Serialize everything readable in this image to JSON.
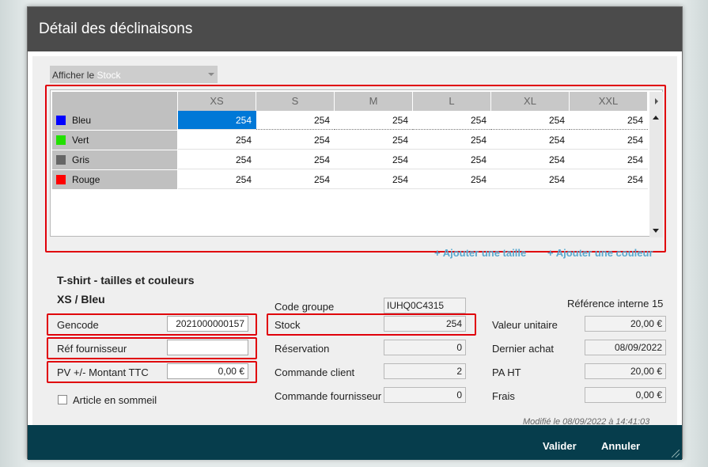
{
  "dialog": {
    "title": "Détail des déclinaisons"
  },
  "selector": {
    "prefix": "Afficher le",
    "value": "Stock"
  },
  "grid": {
    "columns": [
      "XS",
      "S",
      "M",
      "L",
      "XL",
      "XXL"
    ],
    "rows": [
      {
        "name": "Bleu",
        "color": "#0000ff",
        "values": [
          "254",
          "254",
          "254",
          "254",
          "254",
          "254"
        ]
      },
      {
        "name": "Vert",
        "color": "#22e000",
        "values": [
          "254",
          "254",
          "254",
          "254",
          "254",
          "254"
        ]
      },
      {
        "name": "Gris",
        "color": "#666666",
        "values": [
          "254",
          "254",
          "254",
          "254",
          "254",
          "254"
        ]
      },
      {
        "name": "Rouge",
        "color": "#ff0000",
        "values": [
          "254",
          "254",
          "254",
          "254",
          "254",
          "254"
        ]
      }
    ]
  },
  "links": {
    "add_size": "+ Ajouter une taille",
    "add_color": "+ Ajouter une couleur"
  },
  "product": {
    "name": "T-shirt - tailles et couleurs",
    "variant": "XS / Bleu"
  },
  "left_fields": {
    "gencode_label": "Gencode",
    "gencode_value": "2021000000157",
    "ref_label": "Réf fournisseur",
    "ref_value": "",
    "pv_label": "PV +/- Montant TTC",
    "pv_value": "0,00 €",
    "sleep_label": "Article en sommeil"
  },
  "mid_fields": {
    "group_label": "Code groupe",
    "group_value": "IUHQ0C4315",
    "stock_label": "Stock",
    "stock_value": "254",
    "reservation_label": "Réservation",
    "reservation_value": "0",
    "client_label": "Commande client",
    "client_value": "2",
    "supplier_label": "Commande fournisseur",
    "supplier_value": "0"
  },
  "right_fields": {
    "ref_internal": "Référence interne 15",
    "unit_label": "Valeur unitaire",
    "unit_value": "20,00 €",
    "last_label": "Dernier achat",
    "last_value": "08/09/2022",
    "pa_label": "PA HT",
    "pa_value": "20,00 €",
    "fees_label": "Frais",
    "fees_value": "0,00 €"
  },
  "modified": "Modifié le 08/09/2022 à 14:41:03",
  "footer": {
    "validate": "Valider",
    "cancel": "Annuler"
  }
}
